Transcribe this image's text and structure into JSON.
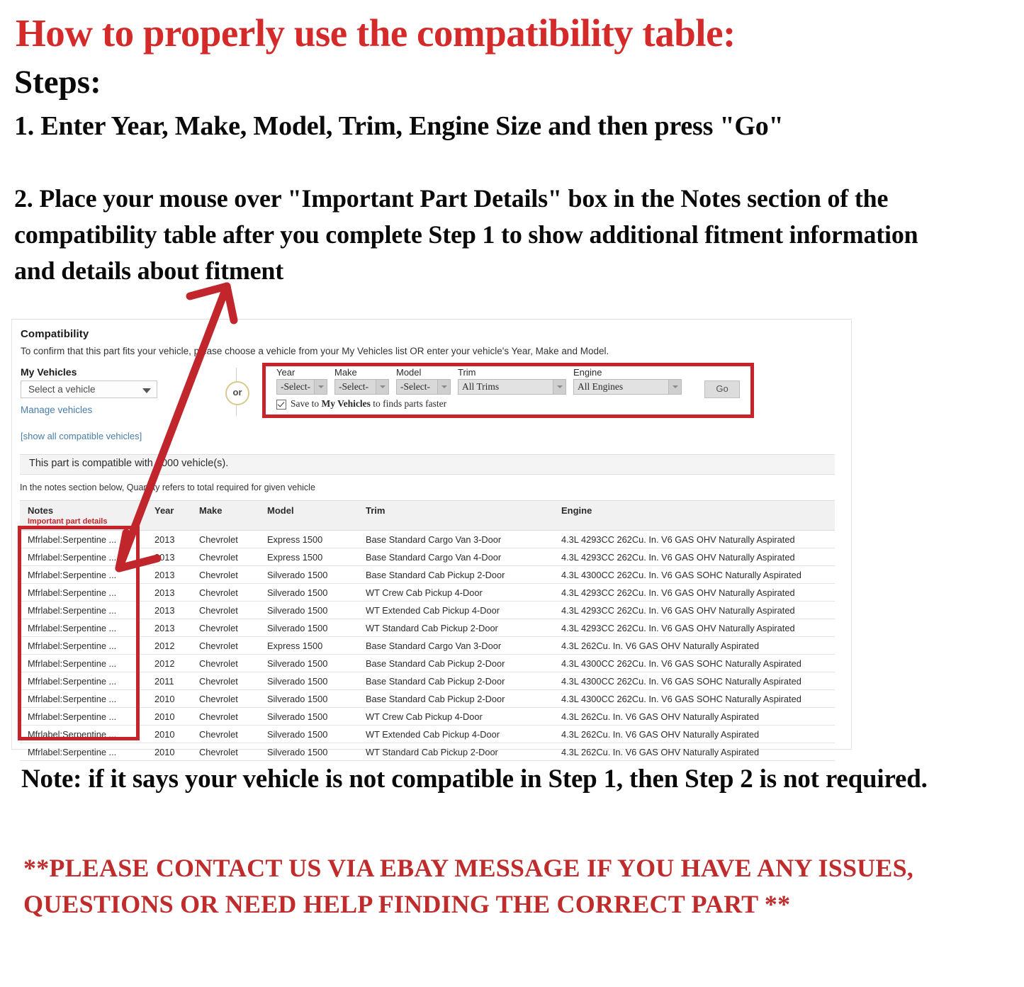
{
  "instructions": {
    "headline": "How to properly use the compatibility table:",
    "steps_label": "Steps:",
    "step1": "1. Enter Year, Make, Model, Trim, Engine Size and then press \"Go\"",
    "step2": "2. Place your mouse over \"Important Part Details\" box in the Notes section of the compatibility table after you complete Step 1 to show additional fitment information and details about fitment",
    "note": "Note: if it says your vehicle is not compatible in Step 1, then Step 2 is not required.",
    "contact": "**PLEASE CONTACT US VIA EBAY MESSAGE IF YOU HAVE ANY ISSUES, QUESTIONS OR NEED HELP FINDING THE CORRECT PART **"
  },
  "colors": {
    "headline_red": "#d42a2a",
    "contact_red": "#c02b2b",
    "highlight_box_red": "#c7232a",
    "link_blue": "#4a7ca8",
    "arrow_red": "#c0262c"
  },
  "compatibility": {
    "title": "Compatibility",
    "subtitle": "To confirm that this part fits your vehicle, please choose a vehicle from your My Vehicles list OR enter your vehicle's Year, Make and Model.",
    "my_vehicles_label": "My Vehicles",
    "vehicle_select_value": "Select a vehicle",
    "manage_vehicles_link": "Manage vehicles",
    "show_all_link": "[show all compatible vehicles]",
    "or_divider": "or",
    "selectors": [
      {
        "label": "Year",
        "value": "-Select-"
      },
      {
        "label": "Make",
        "value": "-Select-"
      },
      {
        "label": "Model",
        "value": "-Select-"
      },
      {
        "label": "Trim",
        "value": "All Trims"
      },
      {
        "label": "Engine",
        "value": "All Engines"
      }
    ],
    "go_button": "Go",
    "save_checkbox_checked": true,
    "save_text_pre": "Save to ",
    "save_text_bold": "My Vehicles",
    "save_text_post": " to finds parts faster",
    "compatible_banner": "This part is compatible with 1000 vehicle(s).",
    "quantity_note": "In the notes section below, Quantity refers to total required for given vehicle"
  },
  "fitment_table": {
    "columns": [
      "Notes",
      "Year",
      "Make",
      "Model",
      "Trim",
      "Engine"
    ],
    "notes_subheader": "Important part details",
    "rows": [
      {
        "notes": "Mfrlabel:Serpentine ...",
        "year": "2013",
        "make": "Chevrolet",
        "model": "Express 1500",
        "trim": "Base Standard Cargo Van 3-Door",
        "engine": "4.3L 4293CC 262Cu. In. V6 GAS OHV Naturally Aspirated"
      },
      {
        "notes": "Mfrlabel:Serpentine ...",
        "year": "2013",
        "make": "Chevrolet",
        "model": "Express 1500",
        "trim": "Base Standard Cargo Van 4-Door",
        "engine": "4.3L 4293CC 262Cu. In. V6 GAS OHV Naturally Aspirated"
      },
      {
        "notes": "Mfrlabel:Serpentine ...",
        "year": "2013",
        "make": "Chevrolet",
        "model": "Silverado 1500",
        "trim": "Base Standard Cab Pickup 2-Door",
        "engine": "4.3L 4300CC 262Cu. In. V6 GAS SOHC Naturally Aspirated"
      },
      {
        "notes": "Mfrlabel:Serpentine ...",
        "year": "2013",
        "make": "Chevrolet",
        "model": "Silverado 1500",
        "trim": "WT Crew Cab Pickup 4-Door",
        "engine": "4.3L 4293CC 262Cu. In. V6 GAS OHV Naturally Aspirated"
      },
      {
        "notes": "Mfrlabel:Serpentine ...",
        "year": "2013",
        "make": "Chevrolet",
        "model": "Silverado 1500",
        "trim": "WT Extended Cab Pickup 4-Door",
        "engine": "4.3L 4293CC 262Cu. In. V6 GAS OHV Naturally Aspirated"
      },
      {
        "notes": "Mfrlabel:Serpentine ...",
        "year": "2013",
        "make": "Chevrolet",
        "model": "Silverado 1500",
        "trim": "WT Standard Cab Pickup 2-Door",
        "engine": "4.3L 4293CC 262Cu. In. V6 GAS OHV Naturally Aspirated"
      },
      {
        "notes": "Mfrlabel:Serpentine ...",
        "year": "2012",
        "make": "Chevrolet",
        "model": "Express 1500",
        "trim": "Base Standard Cargo Van 3-Door",
        "engine": "4.3L 262Cu. In. V6 GAS OHV Naturally Aspirated"
      },
      {
        "notes": "Mfrlabel:Serpentine ...",
        "year": "2012",
        "make": "Chevrolet",
        "model": "Silverado 1500",
        "trim": "Base Standard Cab Pickup 2-Door",
        "engine": "4.3L 4300CC 262Cu. In. V6 GAS SOHC Naturally Aspirated"
      },
      {
        "notes": "Mfrlabel:Serpentine ...",
        "year": "2011",
        "make": "Chevrolet",
        "model": "Silverado 1500",
        "trim": "Base Standard Cab Pickup 2-Door",
        "engine": "4.3L 4300CC 262Cu. In. V6 GAS SOHC Naturally Aspirated"
      },
      {
        "notes": "Mfrlabel:Serpentine ...",
        "year": "2010",
        "make": "Chevrolet",
        "model": "Silverado 1500",
        "trim": "Base Standard Cab Pickup 2-Door",
        "engine": "4.3L 4300CC 262Cu. In. V6 GAS SOHC Naturally Aspirated"
      },
      {
        "notes": "Mfrlabel:Serpentine ...",
        "year": "2010",
        "make": "Chevrolet",
        "model": "Silverado 1500",
        "trim": "WT Crew Cab Pickup 4-Door",
        "engine": "4.3L 262Cu. In. V6 GAS OHV Naturally Aspirated"
      },
      {
        "notes": "Mfrlabel:Serpentine ...",
        "year": "2010",
        "make": "Chevrolet",
        "model": "Silverado 1500",
        "trim": "WT Extended Cab Pickup 4-Door",
        "engine": "4.3L 262Cu. In. V6 GAS OHV Naturally Aspirated"
      },
      {
        "notes": "Mfrlabel:Serpentine ...",
        "year": "2010",
        "make": "Chevrolet",
        "model": "Silverado 1500",
        "trim": "WT Standard Cab Pickup 2-Door",
        "engine": "4.3L 262Cu. In. V6 GAS OHV Naturally Aspirated"
      }
    ]
  }
}
